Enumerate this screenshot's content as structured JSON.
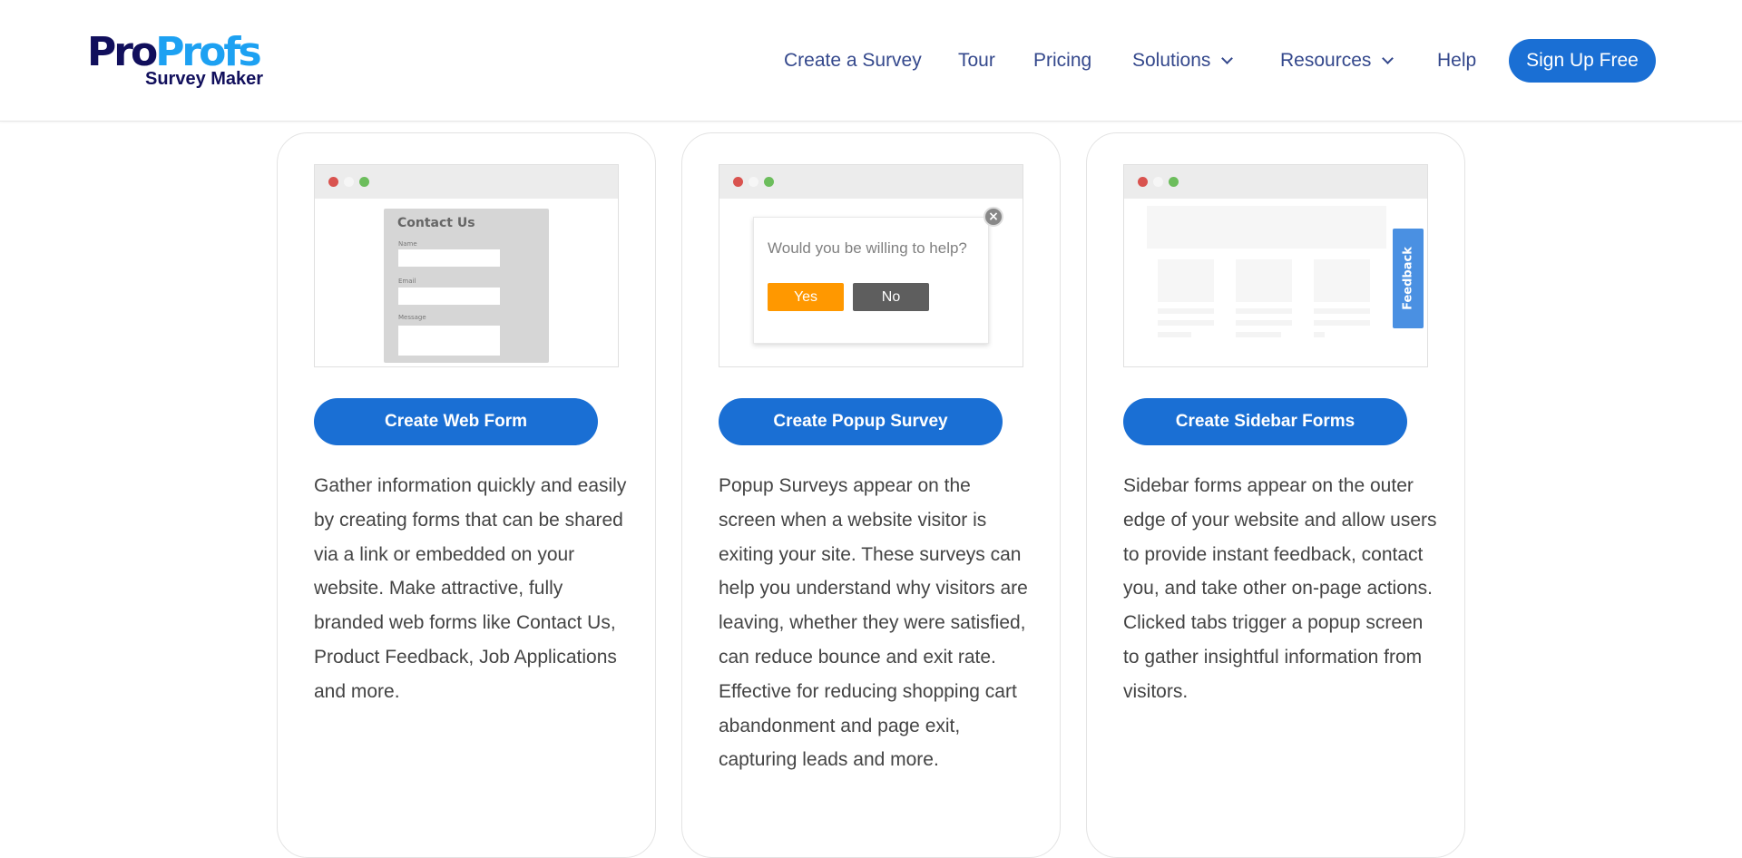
{
  "header": {
    "logo": {
      "part1": "Pro",
      "part2": "Profs",
      "subtitle": "Survey Maker"
    },
    "nav": [
      {
        "label": "Create a Survey",
        "has_dropdown": false
      },
      {
        "label": "Tour",
        "has_dropdown": false
      },
      {
        "label": "Pricing",
        "has_dropdown": false
      },
      {
        "label": "Solutions",
        "has_dropdown": true
      },
      {
        "label": "Resources",
        "has_dropdown": true
      },
      {
        "label": "Help",
        "has_dropdown": false
      }
    ],
    "cta_label": "Sign Up Free"
  },
  "colors": {
    "brand_dark": "#110f5c",
    "brand_light": "#1da1f2",
    "primary_button": "#1a6fd4",
    "nav_text": "#34488c",
    "popup_yes": "#ff9800",
    "popup_no": "#5e5e5e",
    "feedback_tab": "#4a90e2"
  },
  "cards": [
    {
      "mock": {
        "type": "web-form",
        "title": "Contact Us",
        "fields": [
          "Name",
          "Email",
          "Message"
        ]
      },
      "button_label": "Create Web Form",
      "description": "Gather information quickly and easily by creating forms that can be shared via a link or embedded on your website. Make attractive, fully branded web forms like Contact Us, Product Feedback, Job Applications and more."
    },
    {
      "mock": {
        "type": "popup",
        "question": "Would you be willing to help?",
        "yes_label": "Yes",
        "no_label": "No",
        "close_glyph": "×"
      },
      "button_label": "Create Popup Survey",
      "description": "Popup Surveys appear on the screen when a website visitor is exiting your site. These surveys can help you understand why visitors are leaving, whether they were satisfied, can reduce bounce and exit rate. Effective for reducing shopping cart abandonment and page exit, capturing leads and more."
    },
    {
      "mock": {
        "type": "sidebar",
        "tab_label": "Feedback"
      },
      "button_label": "Create Sidebar Forms",
      "description": "Sidebar forms appear on the outer edge of your website and allow users to provide instant feedback, contact you, and take other on-page actions. Clicked tabs trigger a popup screen to gather insightful information from visitors."
    }
  ]
}
